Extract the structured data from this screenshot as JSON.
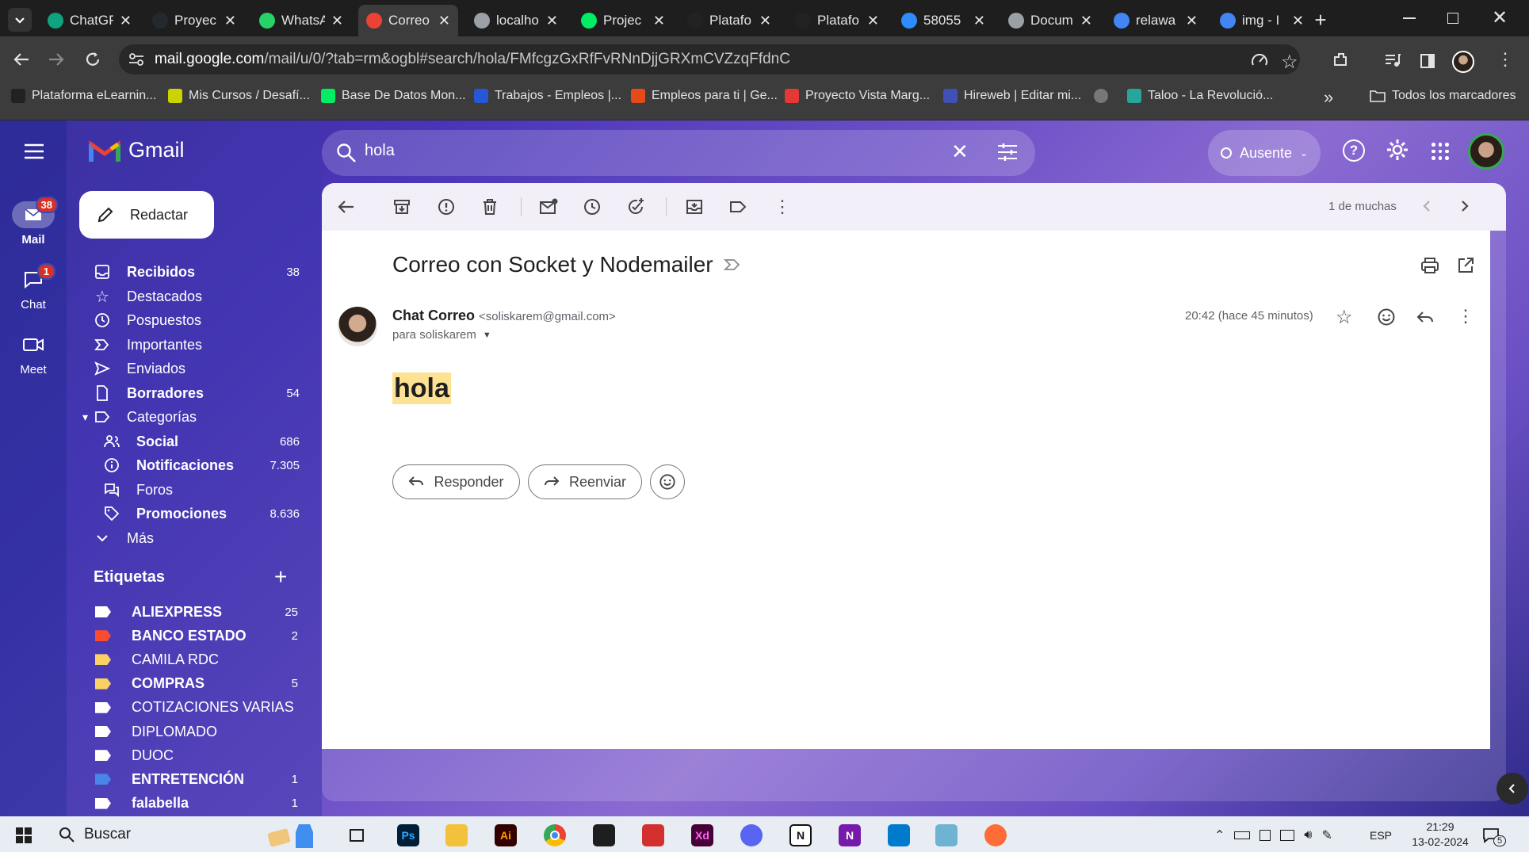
{
  "browser": {
    "tabs": [
      {
        "title": "ChatGP",
        "color": "#10a37f"
      },
      {
        "title": "Proyec",
        "color": "#24292f"
      },
      {
        "title": "WhatsA",
        "color": "#25d366"
      },
      {
        "title": "Correo",
        "color": "#ea4335"
      },
      {
        "title": "localho",
        "color": "#9aa0a6"
      },
      {
        "title": "Projec",
        "color": "#00ed64"
      },
      {
        "title": "Platafo",
        "color": "#222222"
      },
      {
        "title": "Platafo",
        "color": "#222222"
      },
      {
        "title": "58055",
        "color": "#2d8cff"
      },
      {
        "title": "Docum",
        "color": "#9aa0a6"
      },
      {
        "title": "relawa",
        "color": "#4285f4"
      },
      {
        "title": "img - I",
        "color": "#4285f4"
      }
    ],
    "url_domain": "mail.google.com",
    "url_path": "/mail/u/0/?tab=rm&ogbl#search/hola/FMfcgzGxRfFvRNnDjjGRXmCVZzqFfdnC",
    "bookmarks": [
      {
        "label": "Plataforma eLearnin...",
        "color": "#222222"
      },
      {
        "label": "Mis Cursos / Desafí...",
        "color": "#c9d400"
      },
      {
        "label": "Base De Datos Mon...",
        "color": "#00ed64"
      },
      {
        "label": "Trabajos - Empleos |...",
        "color": "#2557d6"
      },
      {
        "label": "Empleos para ti | Ge...",
        "color": "#e64a19"
      },
      {
        "label": "Proyecto Vista Marg...",
        "color": "#e53935"
      },
      {
        "label": "Hireweb | Editar mi...",
        "color": "#3f51b5"
      },
      {
        "label": "",
        "color": "#777777"
      },
      {
        "label": "Taloo - La Revolució...",
        "color": "#26a69a"
      }
    ],
    "bookmarks_all": "Todos los marcadores",
    "chevrons": "»"
  },
  "gmail": {
    "brand": "Gmail",
    "search_value": "hola",
    "status": "Ausente",
    "compose": "Redactar",
    "rail": [
      {
        "label": "Mail",
        "badge": "38"
      },
      {
        "label": "Chat",
        "badge": "1"
      },
      {
        "label": "Meet",
        "badge": ""
      }
    ],
    "nav": [
      {
        "label": "Recibidos",
        "count": "38"
      },
      {
        "label": "Destacados",
        "count": ""
      },
      {
        "label": "Pospuestos",
        "count": ""
      },
      {
        "label": "Importantes",
        "count": ""
      },
      {
        "label": "Enviados",
        "count": ""
      },
      {
        "label": "Borradores",
        "count": "54"
      },
      {
        "label": "Categorías",
        "count": ""
      },
      {
        "label": "Social",
        "count": "686"
      },
      {
        "label": "Notificaciones",
        "count": "7.305"
      },
      {
        "label": "Foros",
        "count": ""
      },
      {
        "label": "Promociones",
        "count": "8.636"
      },
      {
        "label": "Más",
        "count": ""
      }
    ],
    "labels_title": "Etiquetas",
    "labels": [
      {
        "label": "ALIEXPRESS",
        "count": "25",
        "color": "#ffffff"
      },
      {
        "label": "BANCO ESTADO",
        "count": "2",
        "color": "#fb4c2f"
      },
      {
        "label": "CAMILA RDC",
        "count": "",
        "color": "#fad165"
      },
      {
        "label": "COMPRAS",
        "count": "5",
        "color": "#fad165"
      },
      {
        "label": "COTIZACIONES VARIAS",
        "count": "",
        "color": "#ffffff"
      },
      {
        "label": "DIPLOMADO",
        "count": "",
        "color": "#ffffff"
      },
      {
        "label": "DUOC",
        "count": "",
        "color": "#ffffff"
      },
      {
        "label": "ENTRETENCIÓN",
        "count": "1",
        "color": "#4a86e8"
      },
      {
        "label": "falabella",
        "count": "1",
        "color": "#ffffff"
      }
    ],
    "pager": "1 de muchas",
    "message": {
      "subject": "Correo con Socket y Nodemailer",
      "sender_name": "Chat Correo",
      "sender_email": "<soliskarem@gmail.com>",
      "to": "para soliskarem",
      "time": "20:42 (hace 45 minutos)",
      "body": "hola"
    },
    "reply": "Responder",
    "forward": "Reenviar"
  },
  "taskbar": {
    "search": "Buscar",
    "lang": "ESP",
    "time": "21:29",
    "date": "13-02-2024",
    "notif_count": "5",
    "apps": [
      {
        "name": "task-view",
        "color": "#2b2b2b"
      },
      {
        "name": "photoshop",
        "color": "#001e36"
      },
      {
        "name": "file-explorer",
        "color": "#f3c13a"
      },
      {
        "name": "illustrator",
        "color": "#330000"
      },
      {
        "name": "chrome",
        "color": "#4285f4"
      },
      {
        "name": "figma",
        "color": "#1e1e1e"
      },
      {
        "name": "acrobat",
        "color": "#d32f2f"
      },
      {
        "name": "xd",
        "color": "#470137"
      },
      {
        "name": "discord",
        "color": "#5865f2"
      },
      {
        "name": "notion",
        "color": "#ffffff"
      },
      {
        "name": "onenote",
        "color": "#7719aa"
      },
      {
        "name": "vscode",
        "color": "#007acc"
      },
      {
        "name": "notepad",
        "color": "#6fb3d2"
      },
      {
        "name": "postman",
        "color": "#ff6c37"
      }
    ],
    "app_letters": {
      "photoshop": "Ps",
      "illustrator": "Ai",
      "xd": "Xd",
      "notion": "N",
      "onenote": "N"
    }
  }
}
